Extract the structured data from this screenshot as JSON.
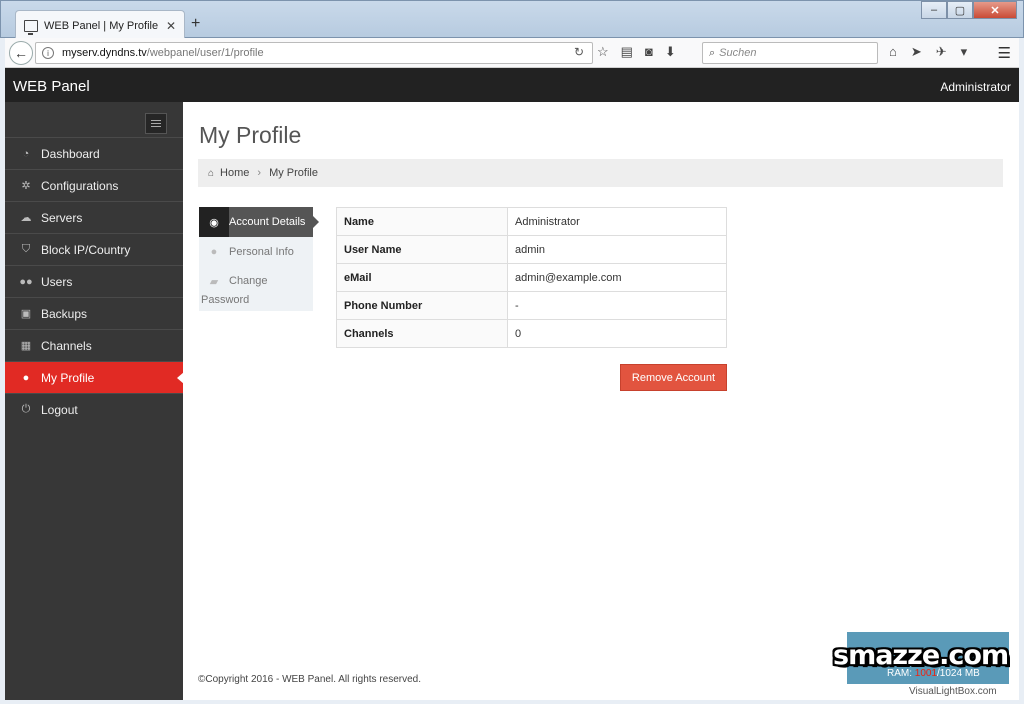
{
  "browser": {
    "tab_title": "WEB Panel | My Profile",
    "tab_close": "✕",
    "new_tab": "+",
    "url_host": "myserv.dyndns.tv",
    "url_path": "/webpanel/user/1/profile",
    "search_placeholder": "Suchen"
  },
  "app": {
    "brand": "WEB Panel",
    "user": "Administrator"
  },
  "sidebar": {
    "items": [
      {
        "label": "Dashboard",
        "icon": "dashboard-icon"
      },
      {
        "label": "Configurations",
        "icon": "gear-icon"
      },
      {
        "label": "Servers",
        "icon": "cloud-icon"
      },
      {
        "label": "Block IP/Country",
        "icon": "shield-icon"
      },
      {
        "label": "Users",
        "icon": "users-icon"
      },
      {
        "label": "Backups",
        "icon": "archive-icon"
      },
      {
        "label": "Channels",
        "icon": "film-icon"
      },
      {
        "label": "My Profile",
        "icon": "user-icon",
        "active": true
      },
      {
        "label": "Logout",
        "icon": "power-icon"
      }
    ]
  },
  "page": {
    "title": "My Profile",
    "breadcrumb": {
      "home": "Home",
      "current": "My Profile"
    }
  },
  "profile_tabs": [
    {
      "label": "Account Details",
      "icon": "eye-icon",
      "active": true
    },
    {
      "label": "Personal Info",
      "icon": "user-icon"
    },
    {
      "label_line1": "Change",
      "label_line2": "Password",
      "icon": "lock-icon"
    }
  ],
  "account": {
    "rows": [
      {
        "key": "Name",
        "value": "Administrator"
      },
      {
        "key": "User Name",
        "value": "admin"
      },
      {
        "key": "eMail",
        "value": "admin@example.com"
      },
      {
        "key": "Phone Number",
        "value": "-"
      },
      {
        "key": "Channels",
        "value": "0"
      }
    ],
    "remove_label": "Remove Account"
  },
  "footer": {
    "copyright": "©Copyright 2016 - WEB Panel. All rights reserved."
  },
  "stats": {
    "ram_label": "RAM:",
    "ram_used": "1001",
    "ram_total": "/1024 MB"
  },
  "watermark": {
    "logo": "smazze.com",
    "site": "VisualLightBox.com"
  },
  "colors": {
    "accent": "#e12a24",
    "button": "#e2543f",
    "header": "#222222",
    "sidebar": "#373737"
  }
}
